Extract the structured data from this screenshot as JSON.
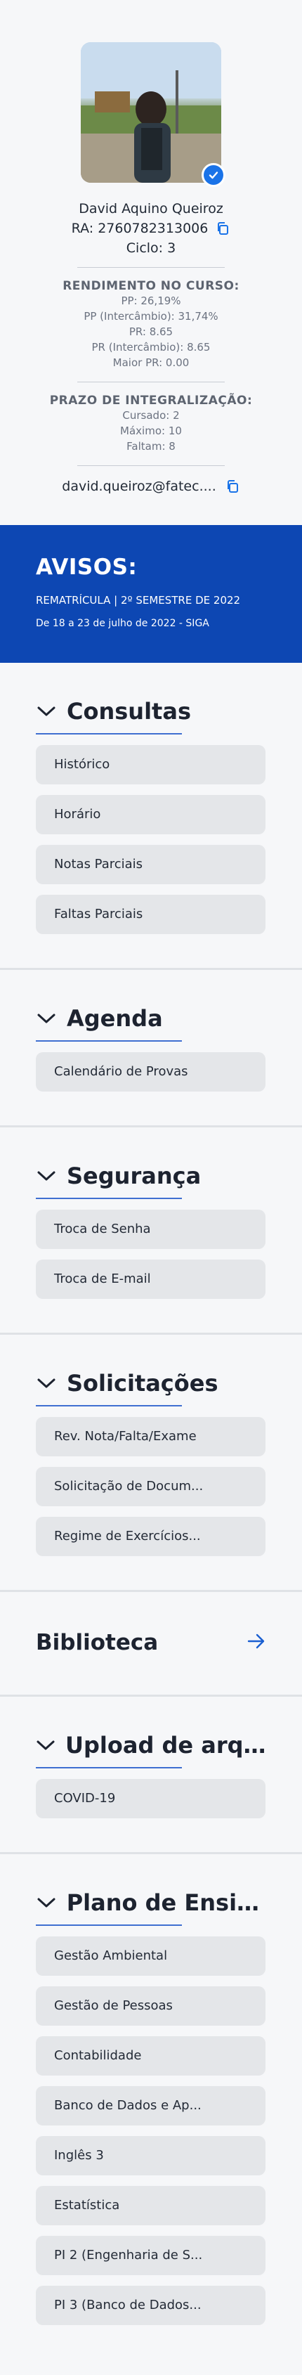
{
  "profile": {
    "name": "David Aquino Queiroz",
    "ra": "RA: 2760782313006",
    "ciclo": "Ciclo: 3",
    "rendimento_title": "RENDIMENTO NO CURSO:",
    "rendimento": [
      "PP: 26,19%",
      "PP (Intercâmbio): 31,74%",
      "PR: 8.65",
      "PR (Intercâmbio): 8.65",
      "Maior PR: 0.00"
    ],
    "prazo_title": "PRAZO DE INTEGRALIZAÇÃO:",
    "prazo": [
      "Cursado: 2",
      "Máximo: 10",
      "Faltam: 8"
    ],
    "email": "david.queiroz@fatec....",
    "icons": {
      "copy": "copy-icon",
      "verified": "check-badge-icon"
    }
  },
  "avisos": {
    "title": "AVISOS:",
    "line1": "REMATRÍCULA | 2º SEMESTRE DE 2022",
    "line2": "De 18 a 23 de julho de 2022 - SIGA"
  },
  "sections": {
    "consultas": {
      "title": "Consultas",
      "items": [
        "Histórico",
        "Horário",
        "Notas Parciais",
        "Faltas Parciais"
      ]
    },
    "agenda": {
      "title": "Agenda",
      "items": [
        "Calendário de Provas"
      ]
    },
    "seguranca": {
      "title": "Segurança",
      "items": [
        "Troca de Senha",
        "Troca de E-mail"
      ]
    },
    "solicitacoes": {
      "title": "Solicitações",
      "items": [
        "Rev. Nota/Falta/Exame",
        "Solicitação de Docum...",
        "Regime de Exercícios..."
      ]
    },
    "biblioteca": {
      "title": "Biblioteca"
    },
    "upload": {
      "title": "Upload de arqu...",
      "items": [
        "COVID-19"
      ]
    },
    "plano": {
      "title": "Plano de Ensino",
      "items": [
        "Gestão Ambiental",
        "Gestão de Pessoas",
        "Contabilidade",
        "Banco de Dados e Ap...",
        "Inglês 3",
        "Estatística",
        "PI 2 (Engenharia de S...",
        "PI 3 (Banco de Dados..."
      ]
    }
  },
  "colors": {
    "accent": "#0d47b3",
    "button_bg": "#e4e6e9",
    "underline": "#3f6fd1"
  }
}
